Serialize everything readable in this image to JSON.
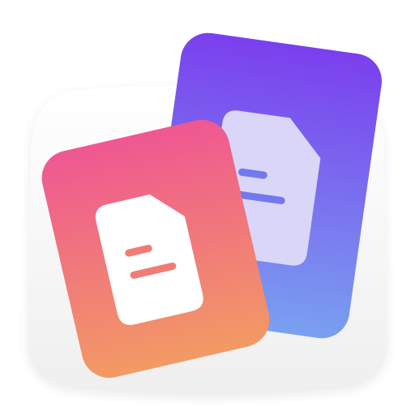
{
  "app_icon": {
    "icon": "document-stack-icon",
    "colors": {
      "squircle_top": "#ffffff",
      "squircle_bottom": "#efefef",
      "back_card_top": "#7b3fee",
      "back_card_bottom": "#79a0f0",
      "front_card_top": "#ef5792",
      "front_card_bottom": "#f29a64",
      "front_doc": "#ffffff",
      "front_doc_lines": "#f07c73",
      "back_doc": "#d9d6f8",
      "back_doc_lines": "#7378ee"
    }
  }
}
